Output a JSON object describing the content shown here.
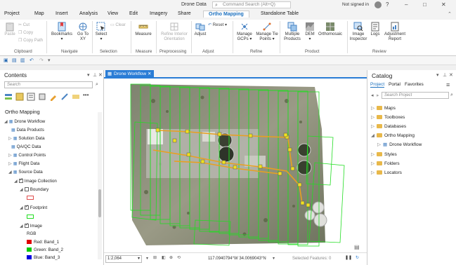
{
  "window": {
    "title": "Drone Data",
    "command_search_placeholder": "Command Search (Alt+Q)",
    "user": "Not signed in"
  },
  "ribbon_tabs": [
    "Project",
    "Map",
    "Insert",
    "Analysis",
    "View",
    "Edit",
    "Imagery",
    "Share",
    "Ortho Mapping",
    "Standalone Table"
  ],
  "active_tab": "Ortho Mapping",
  "ribbon": {
    "clipboard": {
      "paste": "Paste",
      "cut": "Cut",
      "copy": "Copy",
      "copy_path": "Copy Path",
      "label": "Clipboard"
    },
    "navigate": {
      "bookmarks": "Bookmarks",
      "goto": "Go To XY",
      "label": "Navigate"
    },
    "selection": {
      "select": "Select",
      "clear": "Clear",
      "label": "Selection"
    },
    "measure": {
      "measure": "Measure",
      "label": "Measure"
    },
    "preprocessing": {
      "refine": "Refine Interior Orientation",
      "label": "Preprocessing"
    },
    "adjust": {
      "adjust": "Adjust",
      "reset": "Reset",
      "label": "Adjust"
    },
    "refine": {
      "manage_gcps": "Manage GCPs",
      "manage_tie": "Manage Tie Points",
      "label": "Refine"
    },
    "product": {
      "multiple": "Multiple Products",
      "dem": "DEM",
      "ortho": "Orthomosaic",
      "label": "Product"
    },
    "review": {
      "inspector": "Image Inspector",
      "logs": "Logs",
      "report": "Adjustment Report",
      "label": "Review"
    }
  },
  "contents": {
    "title": "Contents",
    "search_placeholder": "Search",
    "heading": "Ortho Mapping",
    "items": [
      "Drone Workflow",
      "Data Products",
      "Solution Data",
      "QA/QC Data",
      "Control Points",
      "Flight Data",
      "Source Data",
      "Image Collection",
      "Boundary",
      "Footprint",
      "Image",
      "RGB"
    ],
    "bands": [
      {
        "label": "Red:  Band_1",
        "color": "#e00000"
      },
      {
        "label": "Green: Band_2",
        "color": "#00cc00"
      },
      {
        "label": "Blue:  Band_3",
        "color": "#0000e0"
      }
    ]
  },
  "map": {
    "tab": "Drone Workflow",
    "scale": "1:2,064",
    "coords": "117.0940794°W 34.0069043°N",
    "selected": "Selected Features: 0"
  },
  "catalog": {
    "title": "Catalog",
    "tabs": [
      "Project",
      "Portal",
      "Favorites"
    ],
    "search_placeholder": "Search Project",
    "items": [
      "Maps",
      "Toolboxes",
      "Databases",
      "Ortho Mapping",
      "Drone Workflow",
      "Styles",
      "Folders",
      "Locators"
    ]
  },
  "colors": {
    "accent": "#1a6fbe",
    "footprint": "#22dd22",
    "boundary": "#e05050"
  }
}
